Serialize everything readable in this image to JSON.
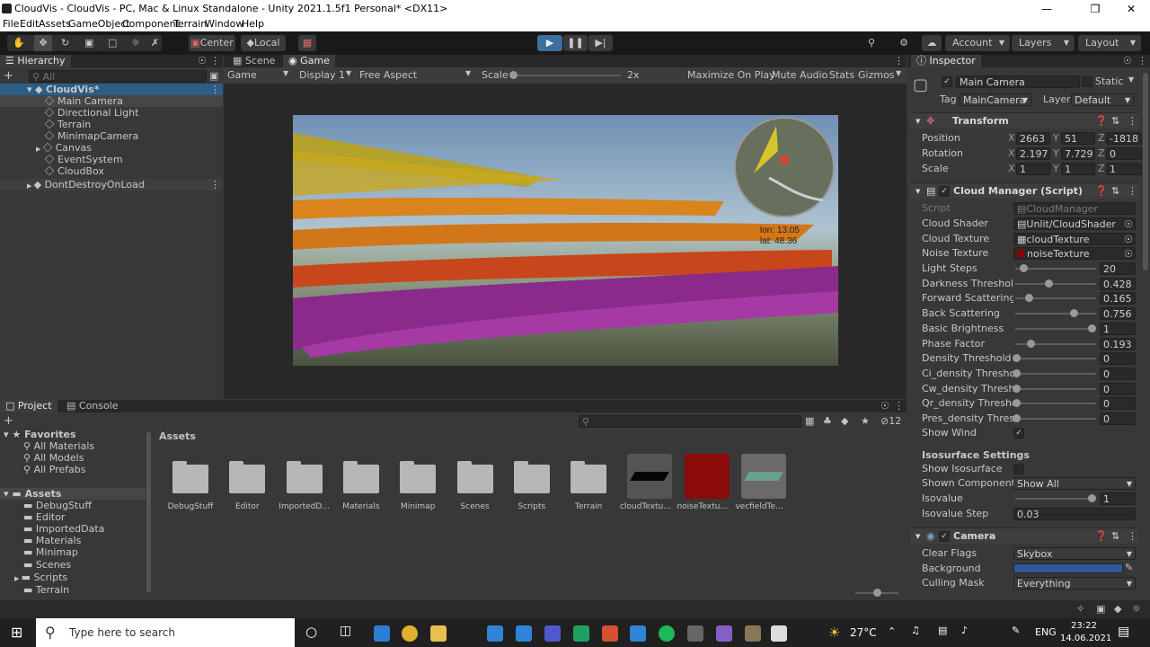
{
  "window": {
    "title": "CloudVis - CloudVis - PC, Mac & Linux Standalone - Unity 2021.1.5f1 Personal* <DX11>"
  },
  "menu": [
    "File",
    "Edit",
    "Assets",
    "GameObject",
    "Component",
    "Terrain",
    "Window",
    "Help"
  ],
  "toolbar": {
    "center": "Center",
    "local": "Local",
    "account": "Account",
    "layers": "Layers",
    "layout": "Layout"
  },
  "hierarchy": {
    "tab": "Hierarchy",
    "search_placeholder": "All",
    "scene": "CloudVis*",
    "items": [
      "Main Camera",
      "Directional Light",
      "Terrain",
      "MinimapCamera",
      "Canvas",
      "EventSystem",
      "CloudBox"
    ],
    "dont_destroy": "DontDestroyOnLoad"
  },
  "game": {
    "tabs": {
      "scene": "Scene",
      "game": "Game"
    },
    "display_mode": "Game",
    "display": "Display 1",
    "aspect": "Free Aspect",
    "scale_label": "Scale",
    "scale_value": "2x",
    "maximize": "Maximize On Play",
    "mute": "Mute Audio",
    "stats": "Stats",
    "gizmos": "Gizmos",
    "overlay_lon": "lon: 13.05",
    "overlay_lat": "lat: 48.36"
  },
  "project": {
    "tabs": {
      "project": "Project",
      "console": "Console"
    },
    "favorites": "Favorites",
    "favorite_items": [
      "All Materials",
      "All Models",
      "All Prefabs"
    ],
    "assets_label": "Assets",
    "asset_folders": [
      "DebugStuff",
      "Editor",
      "ImportedData",
      "Materials",
      "Minimap",
      "Scenes",
      "Scripts",
      "Terrain"
    ],
    "breadcrumb": "Assets",
    "hidden_count": "12",
    "grid": [
      {
        "label": "DebugStuff",
        "kind": "folder"
      },
      {
        "label": "Editor",
        "kind": "folder"
      },
      {
        "label": "ImportedD...",
        "kind": "folder"
      },
      {
        "label": "Materials",
        "kind": "folder"
      },
      {
        "label": "Minimap",
        "kind": "folder"
      },
      {
        "label": "Scenes",
        "kind": "folder"
      },
      {
        "label": "Scripts",
        "kind": "folder"
      },
      {
        "label": "Terrain",
        "kind": "folder"
      },
      {
        "label": "cloudTextu...",
        "kind": "texture-black"
      },
      {
        "label": "noiseTextu...",
        "kind": "texture-red"
      },
      {
        "label": "vecfieldTe...",
        "kind": "texture-green"
      }
    ]
  },
  "inspector": {
    "tab": "Inspector",
    "object_name": "Main Camera",
    "static": "Static",
    "tag_label": "Tag",
    "tag_value": "MainCamera",
    "layer_label": "Layer",
    "layer_value": "Default",
    "transform": {
      "title": "Transform",
      "position_label": "Position",
      "position": {
        "x": "2663",
        "y": "51",
        "z": "-1818"
      },
      "rotation_label": "Rotation",
      "rotation": {
        "x": "2.197",
        "y": "7.729",
        "z": "0"
      },
      "scale_label": "Scale",
      "scale": {
        "x": "1",
        "y": "1",
        "z": "1"
      },
      "axis": {
        "x": "X",
        "y": "Y",
        "z": "Z"
      }
    },
    "cloud_manager": {
      "title": "Cloud Manager (Script)",
      "script_label": "Script",
      "script_value": "CloudManager",
      "cloud_shader_label": "Cloud Shader",
      "cloud_shader": "Unlit/CloudShader",
      "cloud_texture_label": "Cloud Texture",
      "cloud_texture": "cloudTexture",
      "noise_texture_label": "Noise Texture",
      "noise_texture": "noiseTexture",
      "sliders": [
        {
          "label": "Light Steps",
          "value": "20",
          "fraction": 0.1
        },
        {
          "label": "Darkness Threshold",
          "value": "0.428",
          "fraction": 0.428
        },
        {
          "label": "Forward Scattering",
          "value": "0.165",
          "fraction": 0.165
        },
        {
          "label": "Back Scattering",
          "value": "0.756",
          "fraction": 0.756
        },
        {
          "label": "Basic Brightness",
          "value": "1",
          "fraction": 1.0
        },
        {
          "label": "Phase Factor",
          "value": "0.193",
          "fraction": 0.193
        },
        {
          "label": "Density Threshold",
          "value": "0",
          "fraction": 0
        },
        {
          "label": "Ci_density Threshold",
          "value": "0",
          "fraction": 0
        },
        {
          "label": "Cw_density Threshol",
          "value": "0",
          "fraction": 0
        },
        {
          "label": "Qr_density Threshold",
          "value": "0",
          "fraction": 0
        },
        {
          "label": "Pres_density Thresh",
          "value": "0",
          "fraction": 0
        }
      ],
      "show_wind": "Show Wind",
      "iso_header": "Isosurface Settings",
      "show_iso": "Show Isosurface",
      "shown_component_label": "Shown Component",
      "shown_component": "Show All",
      "isovalue_label": "Isovalue",
      "isovalue": "1",
      "isovalue_fraction": 1.0,
      "isovalue_step_label": "Isovalue Step",
      "isovalue_step": "0.03"
    },
    "camera": {
      "title": "Camera",
      "clear_flags_label": "Clear Flags",
      "clear_flags": "Skybox",
      "background_label": "Background",
      "background_color": "#2e5a9a",
      "culling_label": "Culling Mask",
      "culling": "Everything"
    }
  },
  "taskbar": {
    "search_placeholder": "Type here to search",
    "weather": "27°C",
    "lang": "ENG",
    "time": "23:22",
    "date": "14.06.2021"
  },
  "colors": {
    "accent": "#2c5d87",
    "play": "#4a8fd6"
  }
}
